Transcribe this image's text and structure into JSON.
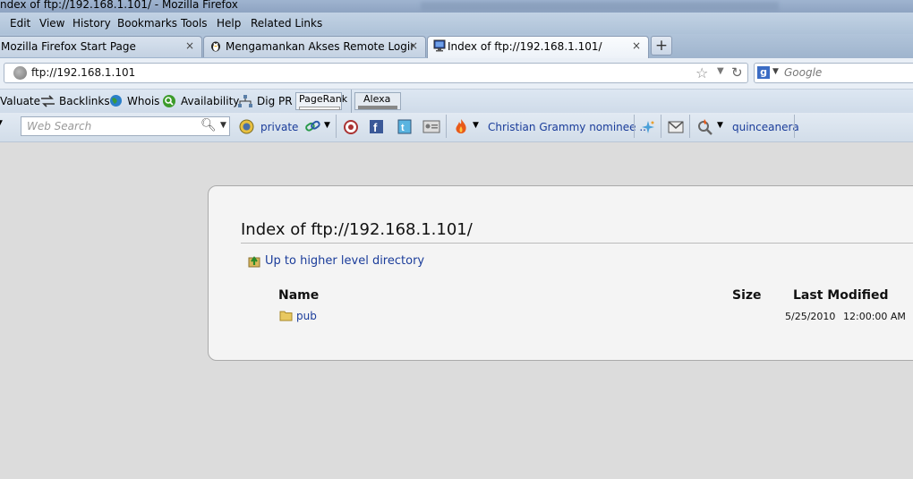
{
  "window": {
    "title": "ndex of ftp://192.168.1.101/ - Mozilla Firefox"
  },
  "menu": {
    "items": [
      "Edit",
      "View",
      "History",
      "Bookmarks",
      "Tools",
      "Help",
      "Related Links"
    ]
  },
  "tabs": [
    {
      "label": "Mozilla Firefox Start Page",
      "active": false
    },
    {
      "label": "Mengamankan Akses Remote Login s...",
      "active": false
    },
    {
      "label": "Index of ftp://192.168.1.101/",
      "active": true
    }
  ],
  "new_tab_label": "+",
  "close_symbol": "×",
  "nav": {
    "url": "ftp://192.168.1.101",
    "search_placeholder": "Google",
    "search_engine_letter": "g"
  },
  "seo_toolbar": {
    "items": [
      "Valuate",
      "Backlinks",
      "Whois",
      "Availability",
      "Dig PR",
      "PageRank",
      "Alexa"
    ]
  },
  "toolbar3": {
    "web_search_placeholder": "Web Search",
    "private_label": "private",
    "news_label": "Christian Grammy nominee ...",
    "query_label": "quinceanera"
  },
  "page": {
    "heading": "Index of ftp://192.168.1.101/",
    "up_link": "Up to higher level directory",
    "columns": {
      "name": "Name",
      "size": "Size",
      "modified": "Last Modified"
    },
    "rows": [
      {
        "name": "pub",
        "size": "",
        "date": "5/25/2010",
        "time": "12:00:00 AM"
      }
    ]
  },
  "colors": {
    "link": "#1a3c9a",
    "chrome": "#b6c8dd",
    "content_bg": "#dcdcdc"
  }
}
